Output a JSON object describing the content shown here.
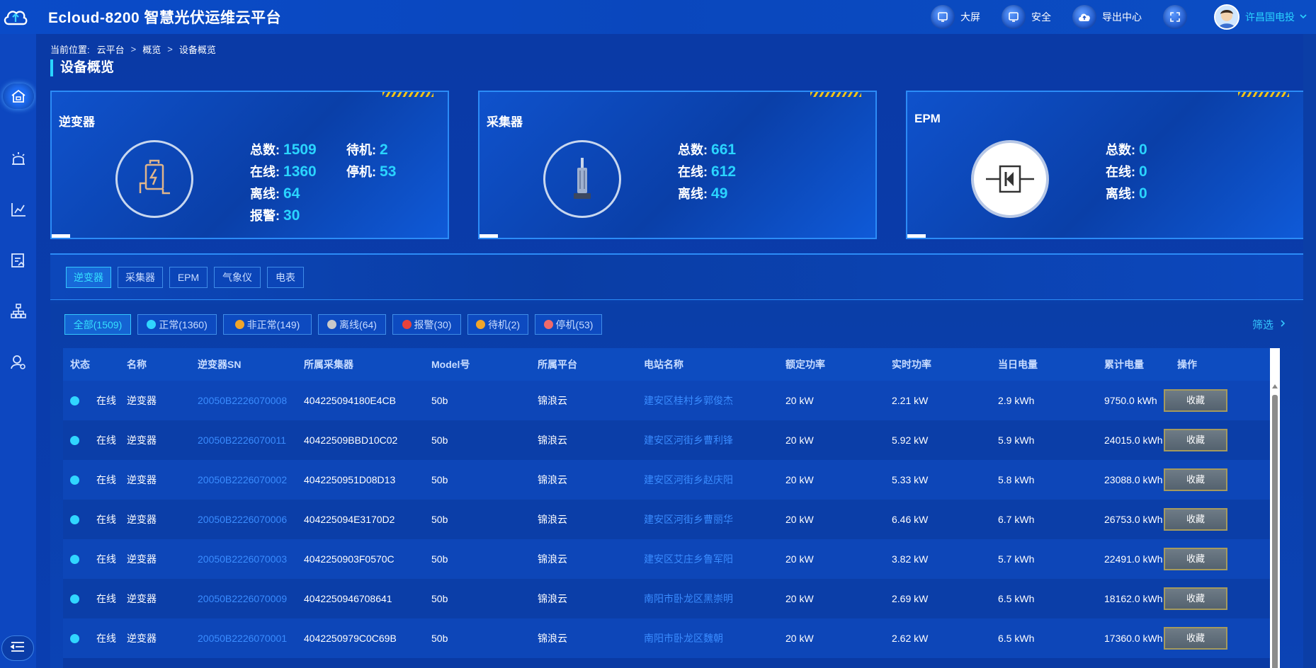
{
  "app": {
    "title": "Ecloud-8200 智慧光伏运维云平台"
  },
  "header": {
    "actions": [
      {
        "label": "大屏",
        "icon": "monitor-icon"
      },
      {
        "label": "安全",
        "icon": "monitor-icon"
      },
      {
        "label": "导出中心",
        "icon": "cloud-upload-icon"
      }
    ],
    "user": "许昌国电投"
  },
  "breadcrumb": {
    "prefix": "当前位置:",
    "items": [
      "云平台",
      "概览",
      "设备概览"
    ],
    "sep": ">"
  },
  "page_title": "设备概览",
  "cards": [
    {
      "title": "逆变器",
      "stats": [
        {
          "label": "总数:",
          "value": "1509"
        },
        {
          "label": "待机:",
          "value": "2"
        },
        {
          "label": "在线:",
          "value": "1360"
        },
        {
          "label": "停机:",
          "value": "53"
        },
        {
          "label": "离线:",
          "value": "64"
        },
        {
          "label": "报警:",
          "value": "30"
        }
      ]
    },
    {
      "title": "采集器",
      "stats": [
        {
          "label": "总数:",
          "value": "661"
        },
        {
          "label": "在线:",
          "value": "612"
        },
        {
          "label": "离线:",
          "value": "49"
        }
      ]
    },
    {
      "title": "EPM",
      "stats": [
        {
          "label": "总数:",
          "value": "0"
        },
        {
          "label": "在线:",
          "value": "0"
        },
        {
          "label": "离线:",
          "value": "0"
        }
      ]
    }
  ],
  "tabs": [
    "逆变器",
    "采集器",
    "EPM",
    "气象仪",
    "电表"
  ],
  "filters": [
    {
      "label": "全部(1509)",
      "dot": ""
    },
    {
      "label": "正常(1360)",
      "dot": "#30d6ff"
    },
    {
      "label": "非正常(149)",
      "dot": "#f0a52a"
    },
    {
      "label": "离线(64)",
      "dot": "#c9c9c9"
    },
    {
      "label": "报警(30)",
      "dot": "#e8423c"
    },
    {
      "label": "待机(2)",
      "dot": "#f0a52a"
    },
    {
      "label": "停机(53)",
      "dot": "#f06a6a"
    }
  ],
  "screen_label": "筛选",
  "table": {
    "headers": [
      "状态",
      "名称",
      "逆变器SN",
      "所属采集器",
      "Model号",
      "所属平台",
      "电站名称",
      "额定功率",
      "实时功率",
      "当日电量",
      "累计电量",
      "操作"
    ],
    "rows": [
      {
        "status": "在线",
        "name": "逆变器",
        "sn": "20050B2226070008",
        "collector": "404225094180E4CB",
        "model": "50b",
        "platform": "锦浪云",
        "station": "建安区桂村乡郭俊杰",
        "rated": "20 kW",
        "realtime": "2.21 kW",
        "daily": "2.9 kWh",
        "total": "9750.0 kWh",
        "action": "收藏"
      },
      {
        "status": "在线",
        "name": "逆变器",
        "sn": "20050B2226070011",
        "collector": "40422509BBD10C02",
        "model": "50b",
        "platform": "锦浪云",
        "station": "建安区河街乡曹利锋",
        "rated": "20 kW",
        "realtime": "5.92 kW",
        "daily": "5.9 kWh",
        "total": "24015.0 kWh",
        "action": "收藏"
      },
      {
        "status": "在线",
        "name": "逆变器",
        "sn": "20050B2226070002",
        "collector": "4042250951D08D13",
        "model": "50b",
        "platform": "锦浪云",
        "station": "建安区河街乡赵庆阳",
        "rated": "20 kW",
        "realtime": "5.33 kW",
        "daily": "5.8 kWh",
        "total": "23088.0 kWh",
        "action": "收藏"
      },
      {
        "status": "在线",
        "name": "逆变器",
        "sn": "20050B2226070006",
        "collector": "404225094E3170D2",
        "model": "50b",
        "platform": "锦浪云",
        "station": "建安区河街乡曹丽华",
        "rated": "20 kW",
        "realtime": "6.46 kW",
        "daily": "6.7 kWh",
        "total": "26753.0 kWh",
        "action": "收藏"
      },
      {
        "status": "在线",
        "name": "逆变器",
        "sn": "20050B2226070003",
        "collector": "4042250903F0570C",
        "model": "50b",
        "platform": "锦浪云",
        "station": "建安区艾庄乡鲁军阳",
        "rated": "20 kW",
        "realtime": "3.82 kW",
        "daily": "5.7 kWh",
        "total": "22491.0 kWh",
        "action": "收藏"
      },
      {
        "status": "在线",
        "name": "逆变器",
        "sn": "20050B2226070009",
        "collector": "4042250946708641",
        "model": "50b",
        "platform": "锦浪云",
        "station": "南阳市卧龙区黑崇明",
        "rated": "20 kW",
        "realtime": "2.69 kW",
        "daily": "6.5 kWh",
        "total": "18162.0 kWh",
        "action": "收藏"
      },
      {
        "status": "在线",
        "name": "逆变器",
        "sn": "20050B2226070001",
        "collector": "4042250979C0C69B",
        "model": "50b",
        "platform": "锦浪云",
        "station": "南阳市卧龙区魏朝",
        "rated": "20 kW",
        "realtime": "2.62 kW",
        "daily": "6.5 kWh",
        "total": "17360.0 kWh",
        "action": "收藏"
      }
    ]
  },
  "colors": {
    "accent": "#2ad4ff",
    "link": "#3a8cff",
    "online": "#30d6ff"
  }
}
